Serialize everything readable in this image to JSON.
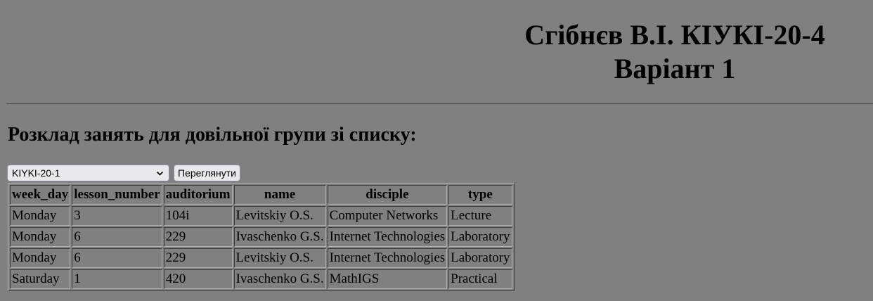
{
  "header": {
    "line1": "Сгібнєв В.І. КІУКІ-20-4",
    "line2": "Варіант 1"
  },
  "section": {
    "heading": "Розклад занять для довільної групи зі списку:"
  },
  "controls": {
    "group_select": {
      "selected": "KIYKI-20-1"
    },
    "view_button_label": "Переглянути"
  },
  "table": {
    "columns": [
      "week_day",
      "lesson_number",
      "auditorium",
      "name",
      "disciple",
      "type"
    ],
    "rows": [
      [
        "Monday",
        "3",
        "104i",
        "Levitskiy O.S.",
        "Computer Networks",
        "Lecture"
      ],
      [
        "Monday",
        "6",
        "229",
        "Ivaschenko G.S.",
        "Internet Technologies",
        "Laboratory"
      ],
      [
        "Monday",
        "6",
        "229",
        "Levitskiy O.S.",
        "Internet Technologies",
        "Laboratory"
      ],
      [
        "Saturday",
        "1",
        "420",
        "Ivaschenko G.S.",
        "MathIGS",
        "Practical"
      ]
    ]
  },
  "colors": {
    "page_background": "#808080",
    "control_background": "#e9e9ed"
  },
  "icons": {
    "select_chevron": "chevron-down-icon"
  }
}
